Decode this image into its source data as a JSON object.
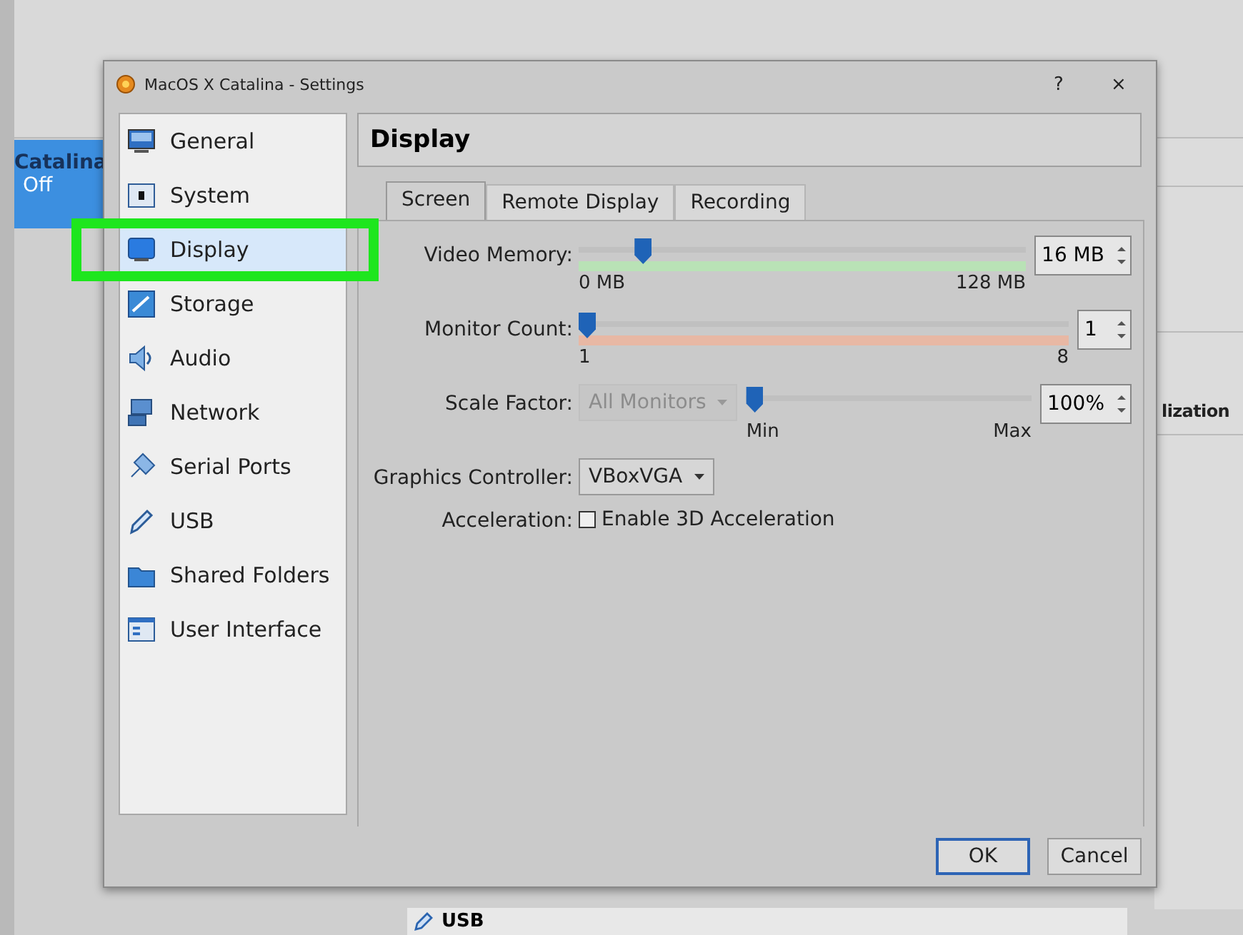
{
  "manager": {
    "vm_item": {
      "name": "Catalina",
      "state": "Off",
      "selected": true
    },
    "details_fragment": "lization",
    "usb_section": "USB"
  },
  "dialog": {
    "title": "MacOS X Catalina - Settings",
    "help_button": "?",
    "close_button": "×"
  },
  "sidebar": {
    "items": [
      {
        "label": "General",
        "selected": false
      },
      {
        "label": "System",
        "selected": false
      },
      {
        "label": "Display",
        "selected": true
      },
      {
        "label": "Storage",
        "selected": false
      },
      {
        "label": "Audio",
        "selected": false
      },
      {
        "label": "Network",
        "selected": false
      },
      {
        "label": "Serial Ports",
        "selected": false
      },
      {
        "label": "USB",
        "selected": false
      },
      {
        "label": "Shared Folders",
        "selected": false
      },
      {
        "label": "User Interface",
        "selected": false
      }
    ]
  },
  "page_title": "Display",
  "tabs": [
    {
      "label": "Screen",
      "selected": true
    },
    {
      "label": "Remote Display",
      "selected": false
    },
    {
      "label": "Recording",
      "selected": false
    }
  ],
  "fields": [
    {
      "kind": "slider",
      "label": "Video Memory:",
      "level": 0.13,
      "color": "#b9e2b6",
      "value": "16 MB",
      "min_label": "0 MB",
      "max_label": "128 MB"
    },
    {
      "kind": "slider",
      "label": "Monitor Count:",
      "level": 0,
      "color": "#e8b8a4",
      "value": "1",
      "min_label": "1",
      "max_label": "8"
    },
    {
      "kind": "slider",
      "label": "Scale Factor:",
      "level": 0,
      "value": "100%",
      "min_label": "Min",
      "max_label": "Max",
      "scope": {
        "text": "All Monitors",
        "disabled": true
      }
    },
    {
      "kind": "combo",
      "label": "Graphics Controller:",
      "value": "VBoxVGA"
    },
    {
      "kind": "checkbox",
      "label": "Acceleration:",
      "text": "Enable 3D Acceleration",
      "checked": false
    }
  ],
  "buttons": [
    {
      "label": "OK",
      "default": true
    },
    {
      "label": "Cancel",
      "default": false
    }
  ]
}
